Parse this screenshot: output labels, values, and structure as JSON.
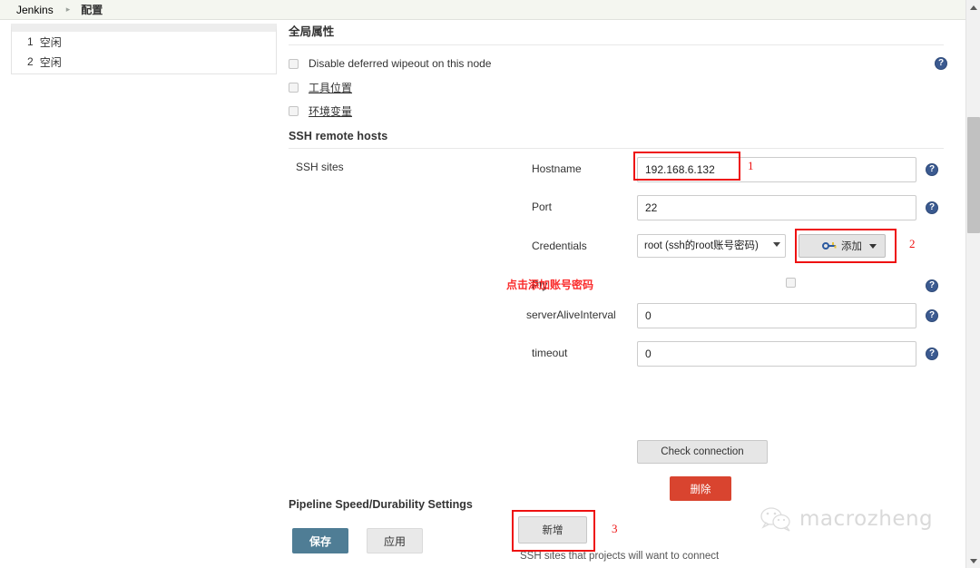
{
  "breadcrumb": {
    "root": "Jenkins",
    "separator": "▸",
    "current": "配置"
  },
  "sidebar": {
    "rows": [
      {
        "index": "1",
        "label": "空闲"
      },
      {
        "index": "2",
        "label": "空闲"
      }
    ]
  },
  "global_properties": {
    "heading": "全局属性",
    "checkboxes": [
      {
        "label": "Disable deferred wipeout on this node",
        "checked": false,
        "link": false
      },
      {
        "label": "工具位置",
        "checked": false,
        "link": true
      },
      {
        "label": "环境变量",
        "checked": false,
        "link": true
      }
    ],
    "help_glyph": "?"
  },
  "ssh_remote_hosts": {
    "heading": "SSH remote hosts",
    "sites_label": "SSH sites",
    "fields": {
      "hostname": {
        "label": "Hostname",
        "value": "192.168.6.132"
      },
      "port": {
        "label": "Port",
        "value": "22"
      },
      "credentials": {
        "label": "Credentials",
        "selected": "root (ssh的root账号密码)",
        "add_button": "添加"
      },
      "pty": {
        "label": "Pty",
        "checked": false
      },
      "server_alive_interval": {
        "label": "serverAliveInterval",
        "value": "0"
      },
      "timeout": {
        "label": "timeout",
        "value": "0"
      }
    },
    "check_connection_button": "Check connection",
    "delete_button": "删除",
    "add_new_button": "新增",
    "helper_text": "SSH sites that projects will want to connect"
  },
  "annotations": {
    "marker_1": "1",
    "marker_2": "2",
    "marker_3": "3",
    "note": "点击添加账号密码",
    "color": "#ee1111"
  },
  "pipeline": {
    "heading": "Pipeline Speed/Durability Settings"
  },
  "footer": {
    "save_label": "保存",
    "apply_label": "应用",
    "save_color": "#4f7d95"
  },
  "watermark": {
    "text": "macrozheng"
  }
}
